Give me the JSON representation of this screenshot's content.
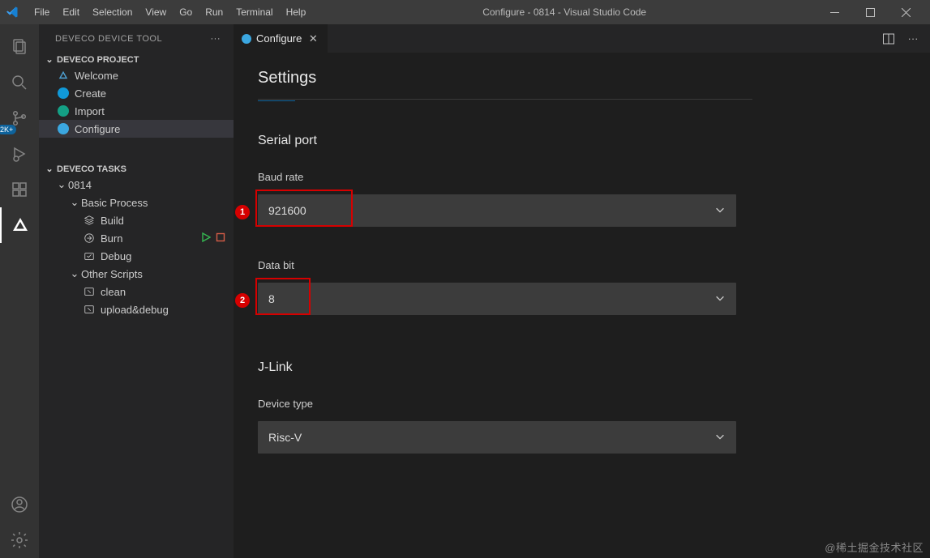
{
  "title_bar": {
    "menu": [
      "File",
      "Edit",
      "Selection",
      "View",
      "Go",
      "Run",
      "Terminal",
      "Help"
    ],
    "title": "Configure - 0814 - Visual Studio Code"
  },
  "activity": {
    "badge_scm": "2K+"
  },
  "sidebar": {
    "title": "DEVECO DEVICE TOOL",
    "sections": {
      "project": {
        "label": "DEVECO PROJECT",
        "items": [
          {
            "label": "Welcome"
          },
          {
            "label": "Create"
          },
          {
            "label": "Import"
          },
          {
            "label": "Configure"
          }
        ]
      },
      "tasks": {
        "label": "DEVECO TASKS",
        "root": "0814",
        "basic": {
          "label": "Basic Process",
          "items": [
            {
              "label": "Build"
            },
            {
              "label": "Burn"
            },
            {
              "label": "Debug"
            }
          ]
        },
        "other": {
          "label": "Other Scripts",
          "items": [
            {
              "label": "clean"
            },
            {
              "label": "upload&debug"
            }
          ]
        }
      }
    }
  },
  "editor": {
    "tab_label": "Configure",
    "settings_label": "Settings"
  },
  "serial_port": {
    "section_title": "Serial port",
    "baud_label": "Baud rate",
    "baud_value": "921600",
    "databit_label": "Data bit",
    "databit_value": "8"
  },
  "jlink": {
    "section_title": "J-Link",
    "device_type_label": "Device type",
    "device_type_value": "Risc-V"
  },
  "annotations": {
    "badge1": "1",
    "badge2": "2"
  },
  "watermark": "@稀土掘金技术社区"
}
